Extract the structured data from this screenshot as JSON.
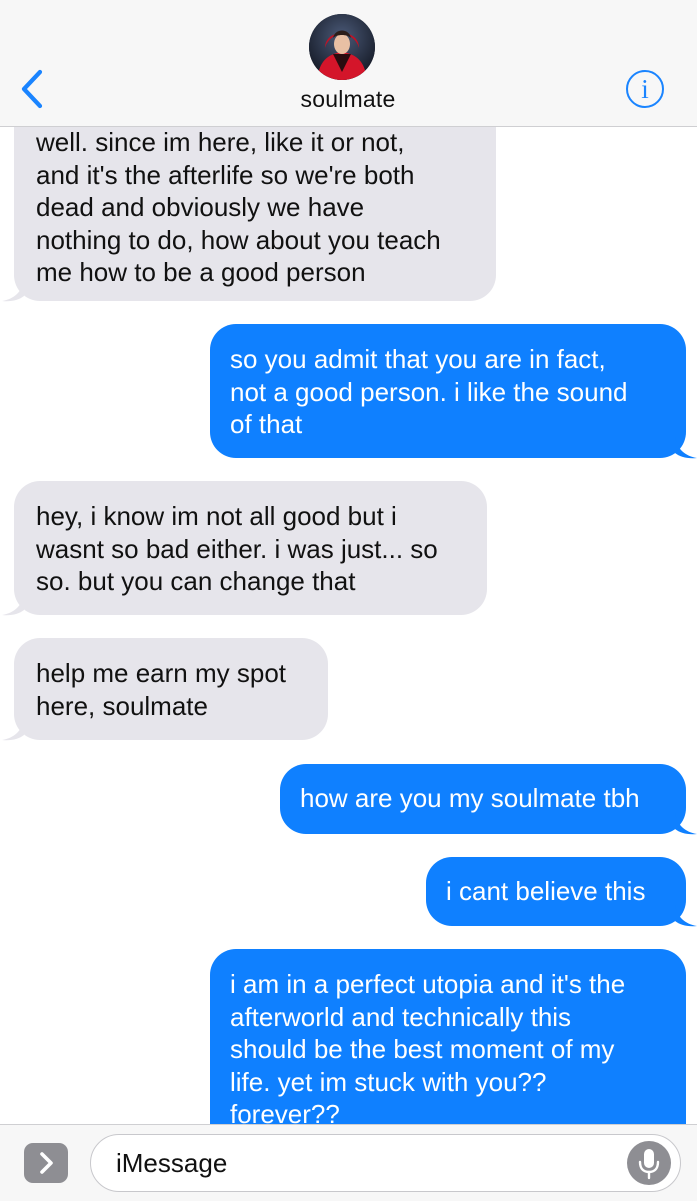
{
  "header": {
    "contact_name": "soulmate",
    "back_icon": "chevron-left-icon",
    "info_icon": "info-icon",
    "info_glyph": "i",
    "accent_color": "#1a84ff"
  },
  "messages": [
    {
      "direction": "received",
      "text": "well. since im here, like it or not,\nand it's the afterlife so we're both\ndead and obviously we have\nnothing to do, how about you teach\nme how to be a good person"
    },
    {
      "direction": "sent",
      "text": "so you admit that you are in fact,\nnot a good person. i like the sound\nof that"
    },
    {
      "direction": "received",
      "text": "hey, i know im not all good but i\nwasnt so bad either. i was just... so\nso. but you can change that"
    },
    {
      "direction": "received",
      "text": "help me earn my spot\nhere, soulmate"
    },
    {
      "direction": "sent",
      "text": "how are you my soulmate tbh"
    },
    {
      "direction": "sent",
      "text": "i cant believe this"
    },
    {
      "direction": "sent",
      "text": "i am in a perfect utopia and it's the\nafterworld and technically this\nshould be the best moment of my\nlife. yet im stuck with you??\nforever??"
    }
  ],
  "colors": {
    "sent_bubble": "#0f80ff",
    "received_bubble": "#e6e5eb"
  },
  "composer": {
    "placeholder": "iMessage",
    "apps_icon": "chevron-right-icon",
    "mic_icon": "microphone-icon"
  }
}
